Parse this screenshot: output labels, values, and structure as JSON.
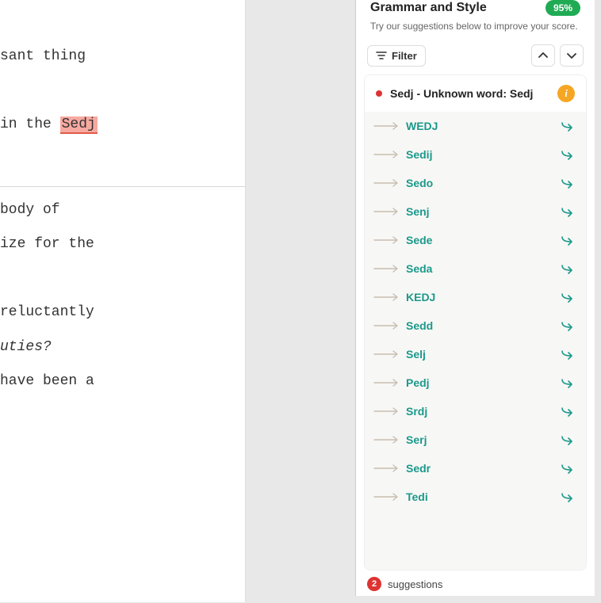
{
  "editor": {
    "lines": [
      {
        "text": "sant thing",
        "style": ""
      },
      {
        "text": "",
        "style": ""
      },
      {
        "text_pre": "in the ",
        "hl": "Sedj",
        "style": ""
      },
      {
        "text": "",
        "style": ""
      },
      {
        "text": "body of",
        "style": "",
        "after_rule": true
      },
      {
        "text": "ize for the",
        "style": ""
      },
      {
        "text": "",
        "style": ""
      },
      {
        "text": " reluctantly",
        "style": ""
      },
      {
        "text": "uties?",
        "style": "italic"
      },
      {
        "text": "have been a",
        "style": ""
      }
    ]
  },
  "panel": {
    "title": "Grammar and Style",
    "score": "95%",
    "subtitle": "Try our suggestions below to improve your score.",
    "filter_label": "Filter",
    "issue": {
      "title": "Sedj - Unknown word: Sedj",
      "suggestions": [
        "WEDJ",
        "Sedij",
        "Sedo",
        "Senj",
        "Sede",
        "Seda",
        "KEDJ",
        "Sedd",
        "Selj",
        "Pedj",
        "Srdj",
        "Serj",
        "Sedr",
        "Tedi"
      ]
    },
    "footer": {
      "count": "2",
      "label": "suggestions"
    }
  }
}
